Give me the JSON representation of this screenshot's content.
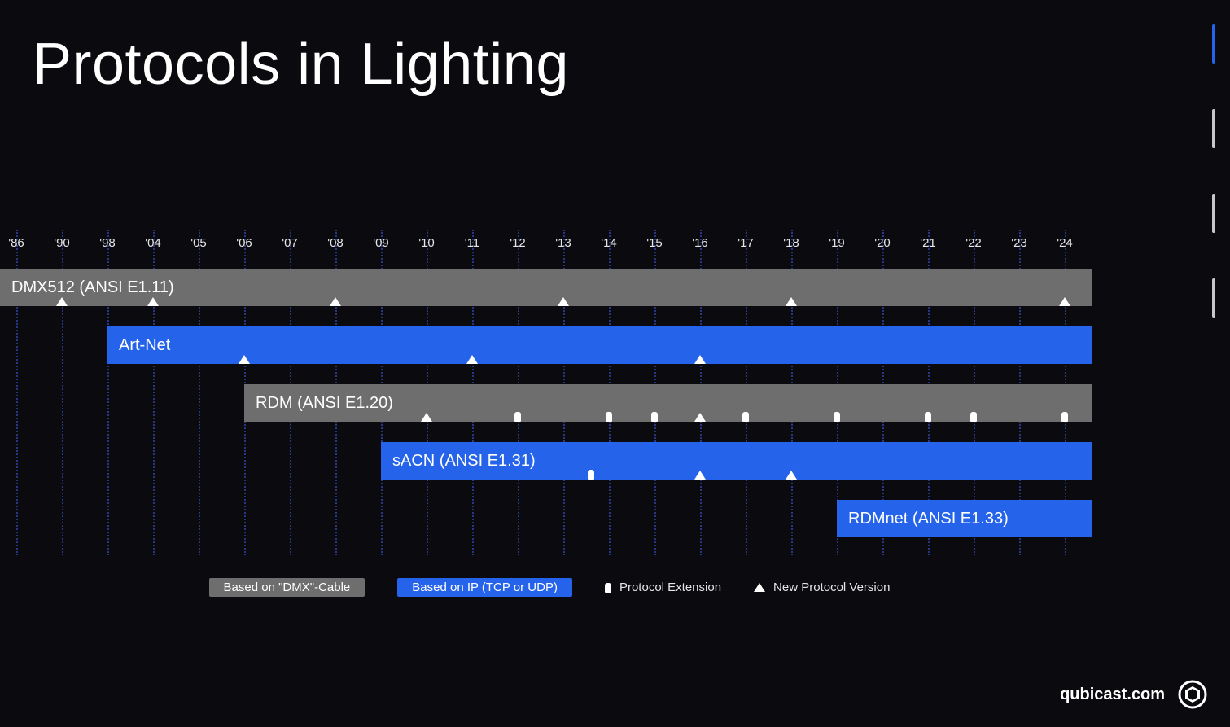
{
  "title": "Protocols in Lighting",
  "footer": {
    "site": "qubicast.com"
  },
  "nav": {
    "active_index": 0,
    "count": 4
  },
  "legend": {
    "cable": "Based on \"DMX\"-Cable",
    "ip": "Based on IP (TCP or UDP)",
    "extension": "Protocol Extension",
    "version": "New Protocol Version"
  },
  "chart_data": {
    "type": "bar",
    "title": "Protocols in Lighting",
    "xlabel": "",
    "ylabel": "",
    "x_ticks": [
      "'86",
      "'90",
      "'98",
      "'04",
      "'05",
      "'06",
      "'07",
      "'08",
      "'09",
      "'10",
      "'11",
      "'12",
      "'13",
      "'14",
      "'15",
      "'16",
      "'17",
      "'18",
      "'19",
      "'20",
      "'21",
      "'22",
      "'23",
      "'24"
    ],
    "tick_index_positions": [
      0,
      1,
      2,
      3,
      4,
      5,
      6,
      7,
      8,
      9,
      10,
      11,
      12,
      13,
      14,
      15,
      16,
      17,
      18,
      19,
      20,
      21,
      22,
      23
    ],
    "series": [
      {
        "name": "DMX512 (ANSI E1.11)",
        "basis": "cable",
        "start_tick_index": 0,
        "end_tick_index": 23,
        "markers": [
          {
            "tick_index": 1,
            "kind": "version"
          },
          {
            "tick_index": 3,
            "kind": "version"
          },
          {
            "tick_index": 7,
            "kind": "version"
          },
          {
            "tick_index": 12,
            "kind": "version"
          },
          {
            "tick_index": 17,
            "kind": "version"
          },
          {
            "tick_index": 23,
            "kind": "version"
          }
        ]
      },
      {
        "name": "Art-Net",
        "basis": "ip",
        "start_tick_index": 2,
        "end_tick_index": 23,
        "markers": [
          {
            "tick_index": 5,
            "kind": "version"
          },
          {
            "tick_index": 10,
            "kind": "version"
          },
          {
            "tick_index": 15,
            "kind": "version"
          }
        ]
      },
      {
        "name": "RDM (ANSI E1.20)",
        "basis": "cable",
        "start_tick_index": 5,
        "end_tick_index": 23,
        "markers": [
          {
            "tick_index": 9,
            "kind": "version"
          },
          {
            "tick_index": 11,
            "kind": "extension"
          },
          {
            "tick_index": 13,
            "kind": "extension"
          },
          {
            "tick_index": 14,
            "kind": "extension"
          },
          {
            "tick_index": 15,
            "kind": "version"
          },
          {
            "tick_index": 16,
            "kind": "extension"
          },
          {
            "tick_index": 18,
            "kind": "extension"
          },
          {
            "tick_index": 20,
            "kind": "extension"
          },
          {
            "tick_index": 21,
            "kind": "extension"
          },
          {
            "tick_index": 23,
            "kind": "extension"
          }
        ]
      },
      {
        "name": "sACN (ANSI E1.31)",
        "basis": "ip",
        "start_tick_index": 8,
        "end_tick_index": 23,
        "markers": [
          {
            "tick_index": 12.6,
            "kind": "extension"
          },
          {
            "tick_index": 15,
            "kind": "version"
          },
          {
            "tick_index": 17,
            "kind": "version"
          }
        ]
      },
      {
        "name": "RDMnet (ANSI E1.33)",
        "basis": "ip",
        "start_tick_index": 18,
        "end_tick_index": 23,
        "markers": []
      }
    ]
  }
}
